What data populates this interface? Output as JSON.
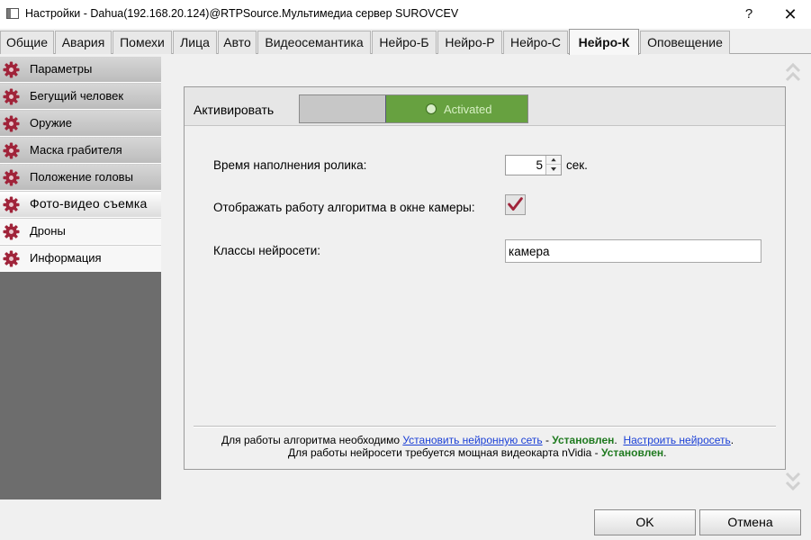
{
  "window": {
    "title": "Настройки - Dahua(192.168.20.124)@RTPSource.Мультимедиа сервер SUROVCEV",
    "help_glyph": "?",
    "close_glyph": "✕"
  },
  "tabs": [
    {
      "label": "Общие"
    },
    {
      "label": "Авария"
    },
    {
      "label": "Помехи"
    },
    {
      "label": "Лица"
    },
    {
      "label": "Авто"
    },
    {
      "label": "Видеосемантика"
    },
    {
      "label": "Нейро-Б"
    },
    {
      "label": "Нейро-Р"
    },
    {
      "label": "Нейро-С"
    },
    {
      "label": "Нейро-К",
      "active": true
    },
    {
      "label": "Оповещение"
    }
  ],
  "sidebar": {
    "items": [
      {
        "label": "Параметры",
        "icon": "gear-icon"
      },
      {
        "label": "Бегущий человек",
        "icon": "gear-icon"
      },
      {
        "label": "Оружие",
        "icon": "gear-icon"
      },
      {
        "label": "Маска грабителя",
        "icon": "gear-icon"
      },
      {
        "label": "Положение головы",
        "icon": "gear-icon"
      },
      {
        "label": "Фото-видео съемка",
        "icon": "gear-icon",
        "selected": true
      },
      {
        "label": "Дроны",
        "icon": "gear-icon"
      },
      {
        "label": "Информация",
        "icon": "gear-icon"
      }
    ]
  },
  "settings": {
    "activate_label": "Активировать",
    "toggle_text": "Activated",
    "clip_fill_label": "Время наполнения ролика:",
    "clip_fill_value": "5",
    "clip_fill_unit": "сек.",
    "show_algo_label": "Отображать работу алгоритма в окне камеры:",
    "show_algo_checked": true,
    "classes_label": "Классы нейросети:",
    "classes_value": "камера"
  },
  "footer": {
    "line1_prefix": "Для работы алгоритма необходимо",
    "install_link": "Установить нейронную сеть",
    "sep1": " - ",
    "status_installed": "Установлен",
    "sep2": ".",
    "configure_link": "Настроить нейросеть",
    "sep3": ".",
    "line2_prefix": "Для работы нейросети требуется мощная видеокарта nVidia - ",
    "status_installed_2": "Установлен",
    "sep4": "."
  },
  "buttons": {
    "ok": "OK",
    "cancel": "Отмена"
  },
  "colors": {
    "accent_gear": "#a0243a",
    "toggle_on": "#67a140",
    "link": "#1a3fd6",
    "status_ok": "#1f7a1f"
  }
}
